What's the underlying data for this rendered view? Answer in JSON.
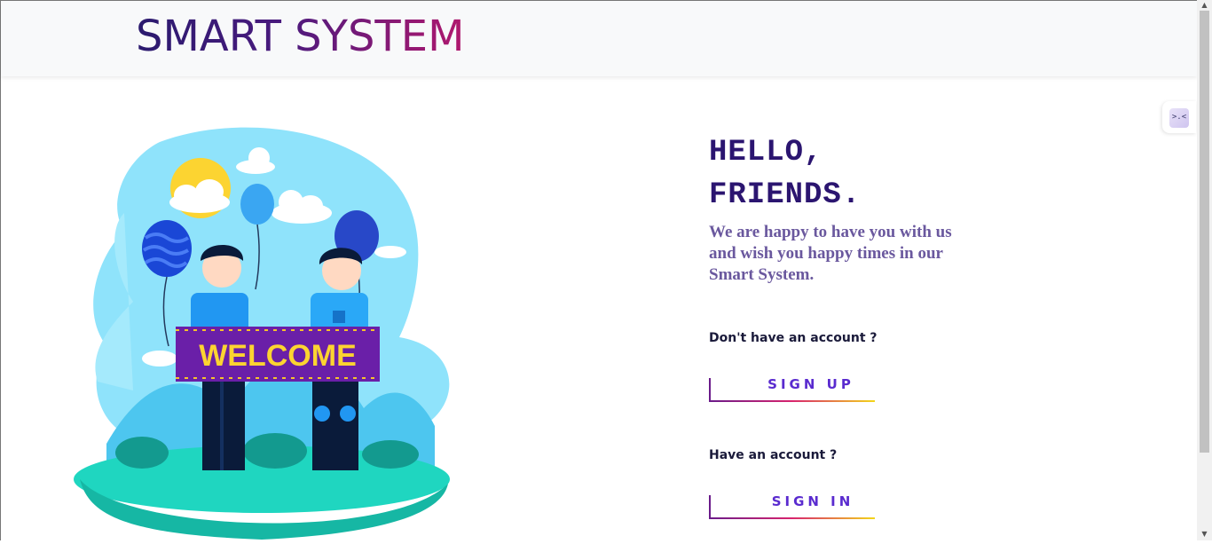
{
  "header": {
    "brand": "SMART SYSTEM"
  },
  "hero": {
    "greeting_line1": "HELLO,",
    "greeting_line2": "FRIENDS.",
    "tagline": "We are happy to have you with us and wish you happy times in our Smart System.",
    "illustration_banner": "WELCOME"
  },
  "auth": {
    "signup_prompt": "Don't have an account ?",
    "signup_label": "SIGN UP",
    "signin_prompt": "Have an account ?",
    "signin_label": "SIGN IN"
  },
  "widget": {
    "face": ">.<"
  },
  "colors": {
    "brand_start": "#2a1a6e",
    "brand_end": "#b0186e",
    "heading": "#2b1570",
    "tagline": "#6a589e",
    "button_text": "#5a2bcf",
    "underline_start": "#6a1b8a",
    "underline_mid": "#d8246e",
    "underline_end": "#f3d61a"
  },
  "icons": [
    "welcome-illustration",
    "sun-icon",
    "balloon-icon",
    "cloud-icon"
  ]
}
